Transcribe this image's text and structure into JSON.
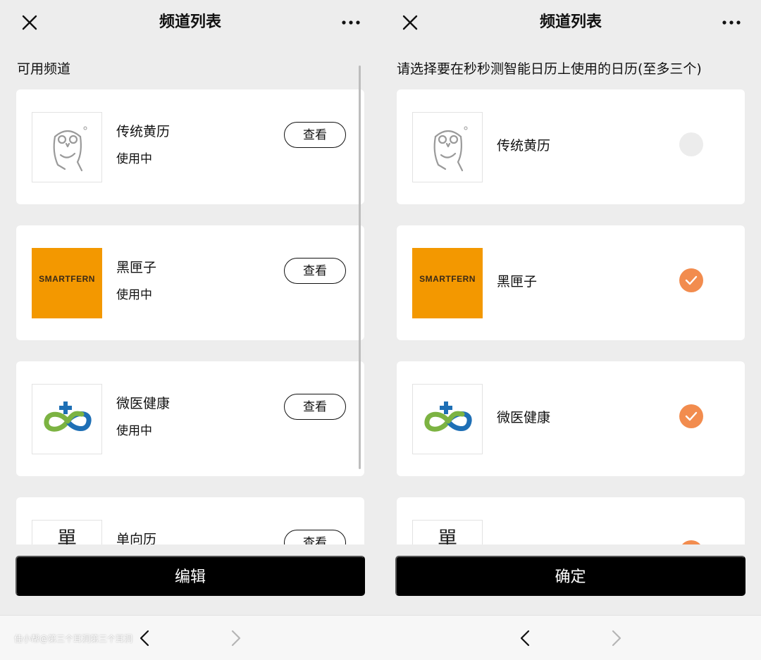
{
  "left_panel": {
    "title": "频道列表",
    "section_label": "可用频道",
    "view_label": "查看",
    "channels": [
      {
        "name": "传统黄历",
        "status": "使用中",
        "logo": "owl-icon"
      },
      {
        "name": "黑匣子",
        "status": "使用中",
        "logo": "smartfern-logo",
        "logo_text": "SMARTFERN"
      },
      {
        "name": "微医健康",
        "status": "使用中",
        "logo": "weiyi-infinity-cross-icon"
      },
      {
        "name": "单向历",
        "status": "",
        "logo": "dan-character-logo",
        "logo_text": "單"
      }
    ],
    "edit_button": "编辑"
  },
  "right_panel": {
    "title": "频道列表",
    "section_label": "请选择要在秒秒测智能日历上使用的日历(至多三个)",
    "channels": [
      {
        "name": "传统黄历",
        "selected": false,
        "logo": "owl-icon"
      },
      {
        "name": "黑匣子",
        "selected": true,
        "logo": "smartfern-logo",
        "logo_text": "SMARTFERN"
      },
      {
        "name": "微医健康",
        "selected": true,
        "logo": "weiyi-infinity-cross-icon"
      },
      {
        "name": "",
        "selected": true,
        "logo": "dan-character-logo",
        "logo_text": "單"
      }
    ],
    "confirm_button": "确定"
  },
  "bottom_bar": {
    "watermark": "佳小帮@第三个耳洞第三个耳洞"
  },
  "colors": {
    "accent_check": "#f28c4e",
    "logo_orange": "#f39800",
    "button_black": "#000000",
    "page_bg": "#ededed"
  }
}
